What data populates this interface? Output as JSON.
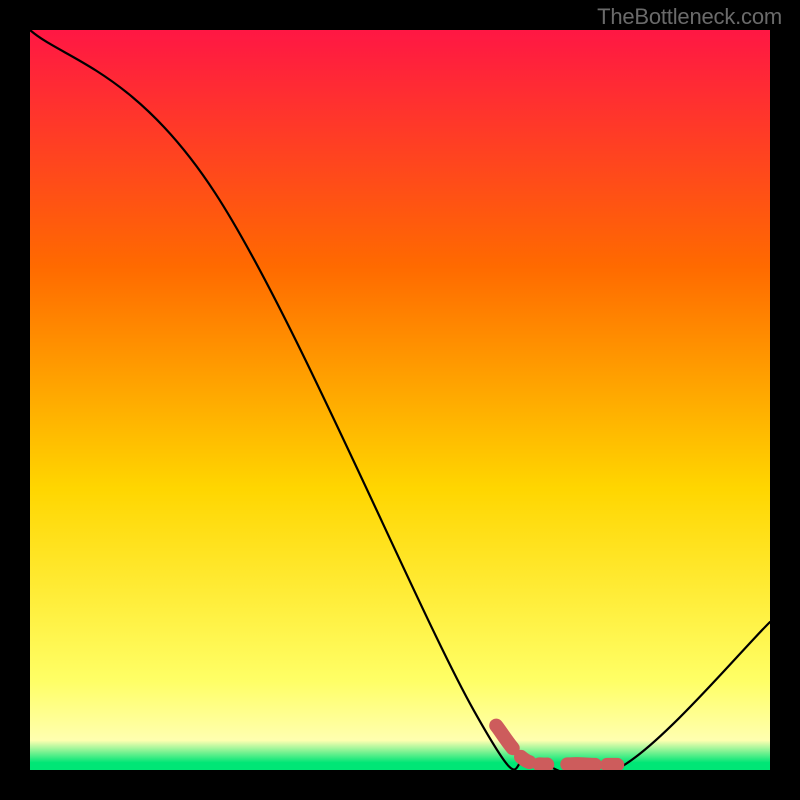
{
  "attribution": "TheBottleneck.com",
  "chart_data": {
    "type": "line",
    "title": "",
    "xlabel": "",
    "ylabel": "",
    "xlim": [
      0,
      100
    ],
    "ylim": [
      0,
      100
    ],
    "curve": [
      {
        "x": 0,
        "y": 100
      },
      {
        "x": 25,
        "y": 78
      },
      {
        "x": 60,
        "y": 8
      },
      {
        "x": 68,
        "y": 1.5
      },
      {
        "x": 80,
        "y": 0.5
      },
      {
        "x": 100,
        "y": 20
      }
    ],
    "highlight_segment": {
      "color": "#cd5c5c",
      "points": [
        {
          "x": 63,
          "y": 6
        },
        {
          "x": 67,
          "y": 1.3
        },
        {
          "x": 72,
          "y": 0.8
        },
        {
          "x": 74,
          "y": 0.8
        },
        {
          "x": 76,
          "y": 0.7
        },
        {
          "x": 80,
          "y": 0.7
        }
      ]
    },
    "background_gradient": {
      "top": "#ff1744",
      "mid1": "#ff6a00",
      "mid2": "#ffd600",
      "low": "#ffff66",
      "bottom": "#00e676"
    }
  }
}
